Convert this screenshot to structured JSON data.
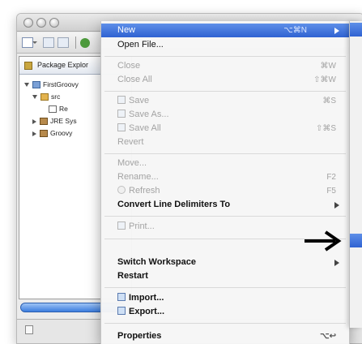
{
  "window": {
    "explorer_tab_label": "Package Explor",
    "tree": [
      {
        "label": "FirstGroovy",
        "icon": "project-icon"
      },
      {
        "label": "src",
        "icon": "source-folder-icon"
      },
      {
        "label": "Re",
        "icon": "package-icon"
      },
      {
        "label": "JRE Sys",
        "icon": "library-icon"
      },
      {
        "label": "Groovy",
        "icon": "library-icon"
      }
    ]
  },
  "menu": {
    "new": {
      "label": "New",
      "shortcut": "⌥⌘N"
    },
    "open_file": {
      "label": "Open File..."
    },
    "close": {
      "label": "Close",
      "shortcut": "⌘W"
    },
    "close_all": {
      "label": "Close All",
      "shortcut": "⇧⌘W"
    },
    "save": {
      "label": "Save",
      "shortcut": "⌘S"
    },
    "save_as": {
      "label": "Save As..."
    },
    "save_all": {
      "label": "Save All",
      "shortcut": "⇧⌘S"
    },
    "revert": {
      "label": "Revert"
    },
    "move": {
      "label": "Move..."
    },
    "rename": {
      "label": "Rename...",
      "shortcut": "F2"
    },
    "refresh": {
      "label": "Refresh",
      "shortcut": "F5"
    },
    "convert": {
      "label": "Convert Line Delimiters To"
    },
    "print": {
      "label": "Print..."
    },
    "switch_workspace": {
      "label": "Switch Workspace"
    },
    "restart": {
      "label": "Restart"
    },
    "import": {
      "label": "Import..."
    },
    "export": {
      "label": "Export..."
    },
    "properties": {
      "label": "Properties",
      "shortcut": "⌥↩"
    }
  },
  "colors": {
    "highlight": "#2f62d2",
    "disabled_text": "#a3a3a3"
  }
}
